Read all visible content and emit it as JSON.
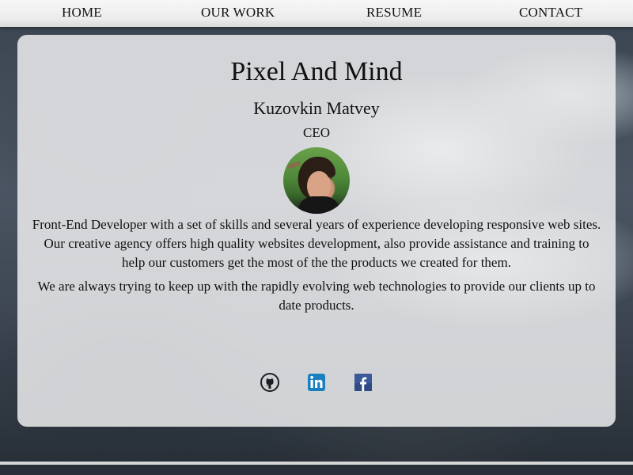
{
  "nav": {
    "items": [
      {
        "label": "HOME"
      },
      {
        "label": "OUR WORK"
      },
      {
        "label": "RESUME"
      },
      {
        "label": "CONTACT"
      }
    ]
  },
  "profile": {
    "title": "Pixel And Mind",
    "name": "Kuzovkin Matvey",
    "role": "CEO",
    "description": [
      "Front-End Developer with a set of skills and several years of experience developing responsive web sites. Our creative agency offers high quality websites development, also provide assistance and training to help our customers get the most of the the products we created for them.",
      "We are always trying to keep up with the rapidly evolving web technologies to provide our clients up to date products."
    ]
  },
  "social": [
    {
      "icon": "github-icon",
      "color": "#1b1f23"
    },
    {
      "icon": "linkedin-icon",
      "color": "#1a7fc1"
    },
    {
      "icon": "facebook-icon",
      "color": "#3b5998"
    }
  ],
  "colors": {
    "nav_bg": "#efefef",
    "card_bg": "#ececee"
  }
}
